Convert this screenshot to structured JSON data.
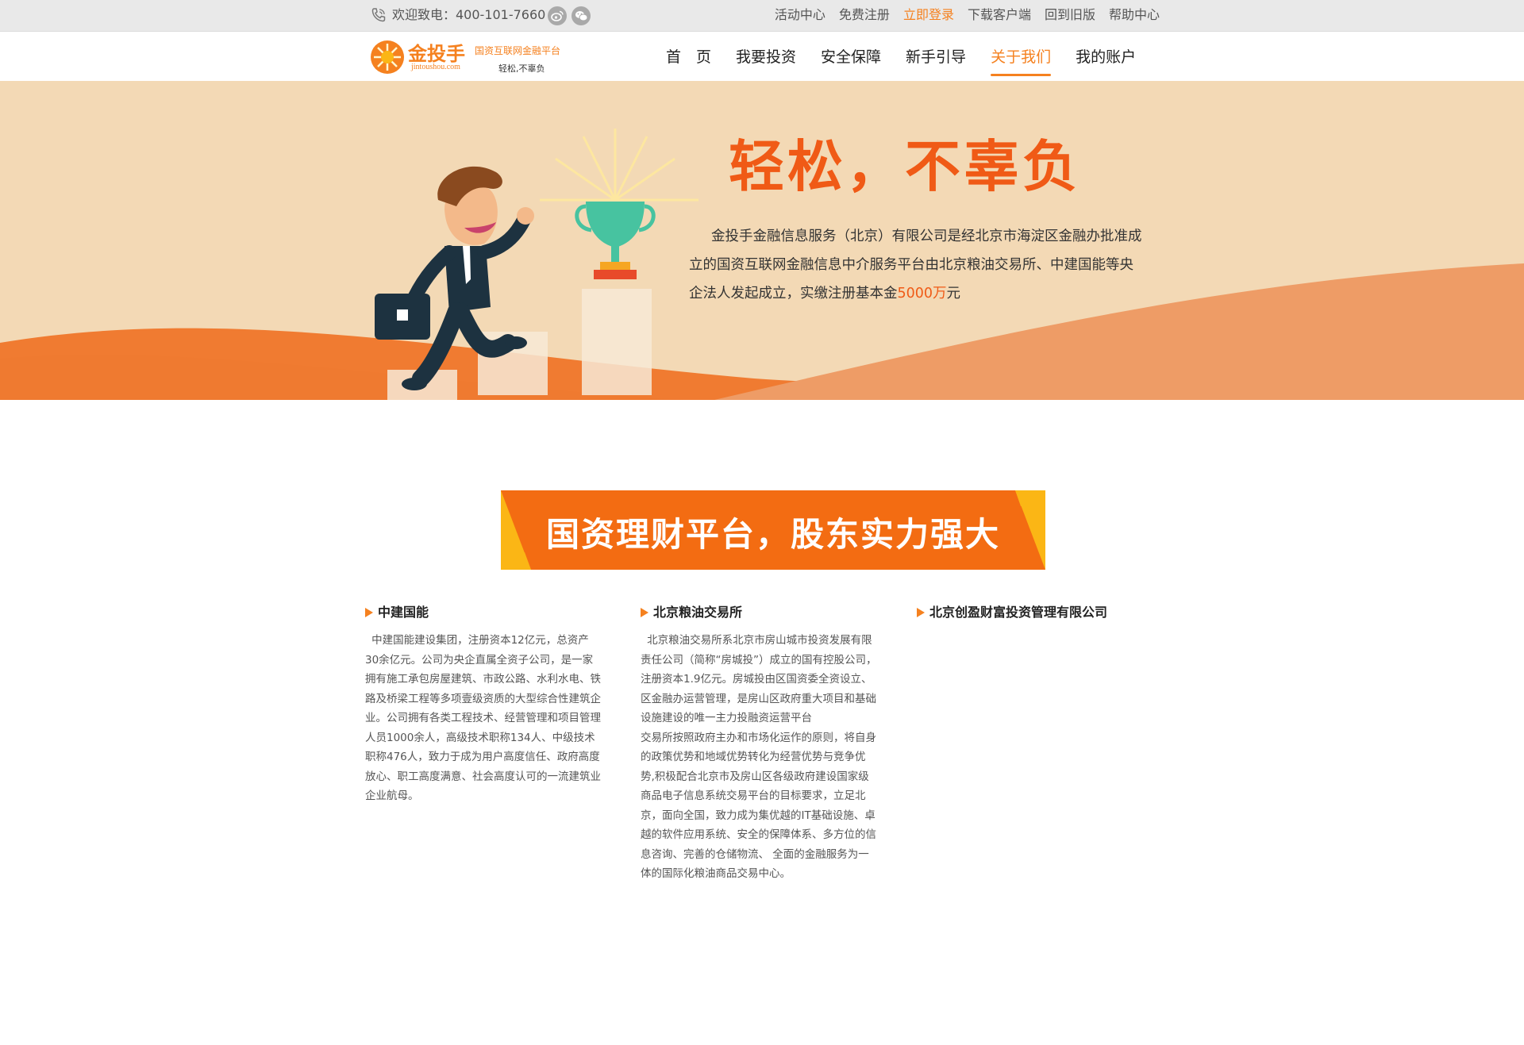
{
  "topbar": {
    "phone_text": "欢迎致电：400-101-7660",
    "links": [
      "活动中心",
      "免费注册",
      "立即登录",
      "下载客户端",
      "回到旧版",
      "帮助中心"
    ],
    "active_link": "立即登录"
  },
  "logo": {
    "name": "金投手",
    "url": "jintoushou.com",
    "tagline": "国资互联网金融平台",
    "slogan": "轻松,不辜负"
  },
  "nav": {
    "items": [
      "首　页",
      "我要投资",
      "安全保障",
      "新手引导",
      "关于我们",
      "我的账户"
    ],
    "active": "关于我们"
  },
  "banner": {
    "headline": "轻松，不辜负",
    "intro_before": "金投手金融信息服务（北京）有限公司是经北京市海淀区金融办批准成立的国资互联网金融信息中介服务平台由北京粮油交易所、中建国能等央企法人发起成立，实缴注册基本金",
    "intro_highlight": "5000万",
    "intro_after": "元"
  },
  "section": {
    "title": "国资理财平台，股东实力强大"
  },
  "companies": [
    {
      "name": "中建国能",
      "desc": "中建国能建设集团，注册资本12亿元，总资产30余亿元。公司为央企直属全资子公司，是一家拥有施工承包房屋建筑、市政公路、水利水电、铁路及桥梁工程等多项壹级资质的大型综合性建筑企业。公司拥有各类工程技术、经营管理和项目管理人员1000余人，高级技术职称134人、中级技术职称476人，致力于成为用户高度信任、政府高度放心、职工高度满意、社会高度认可的一流建筑业企业航母。"
    },
    {
      "name": "北京粮油交易所",
      "desc": "北京粮油交易所系北京市房山城市投资发展有限责任公司（简称“房城投”）成立的国有控股公司，注册资本1.9亿元。房城投由区国资委全资设立、区金融办运营管理，是房山区政府重大项目和基础设施建设的唯一主力投融资运营平台\n  交易所按照政府主办和市场化运作的原则，将自身的政策优势和地域优势转化为经营优势与竞争优势,积极配合北京市及房山区各级政府建设国家级商品电子信息系统交易平台的目标要求，立足北京，面向全国，致力成为集优越的IT基础设施、卓越的软件应用系统、安全的保障体系、多方位的信息咨询、完善的仓储物流、 全面的金融服务为一体的国际化粮油商品交易中心。"
    },
    {
      "name": "北京创盈财富投资管理有限公司",
      "desc": ""
    }
  ],
  "colors": {
    "accent": "#f5811f",
    "headline": "#f05a16",
    "banner_bg": "#f3d9b5",
    "ribbon": "#f36c12",
    "ribbon_edge": "#fbb615"
  },
  "icons": [
    "phone-icon",
    "weibo-icon",
    "wechat-icon",
    "triangle-bullet-icon"
  ]
}
